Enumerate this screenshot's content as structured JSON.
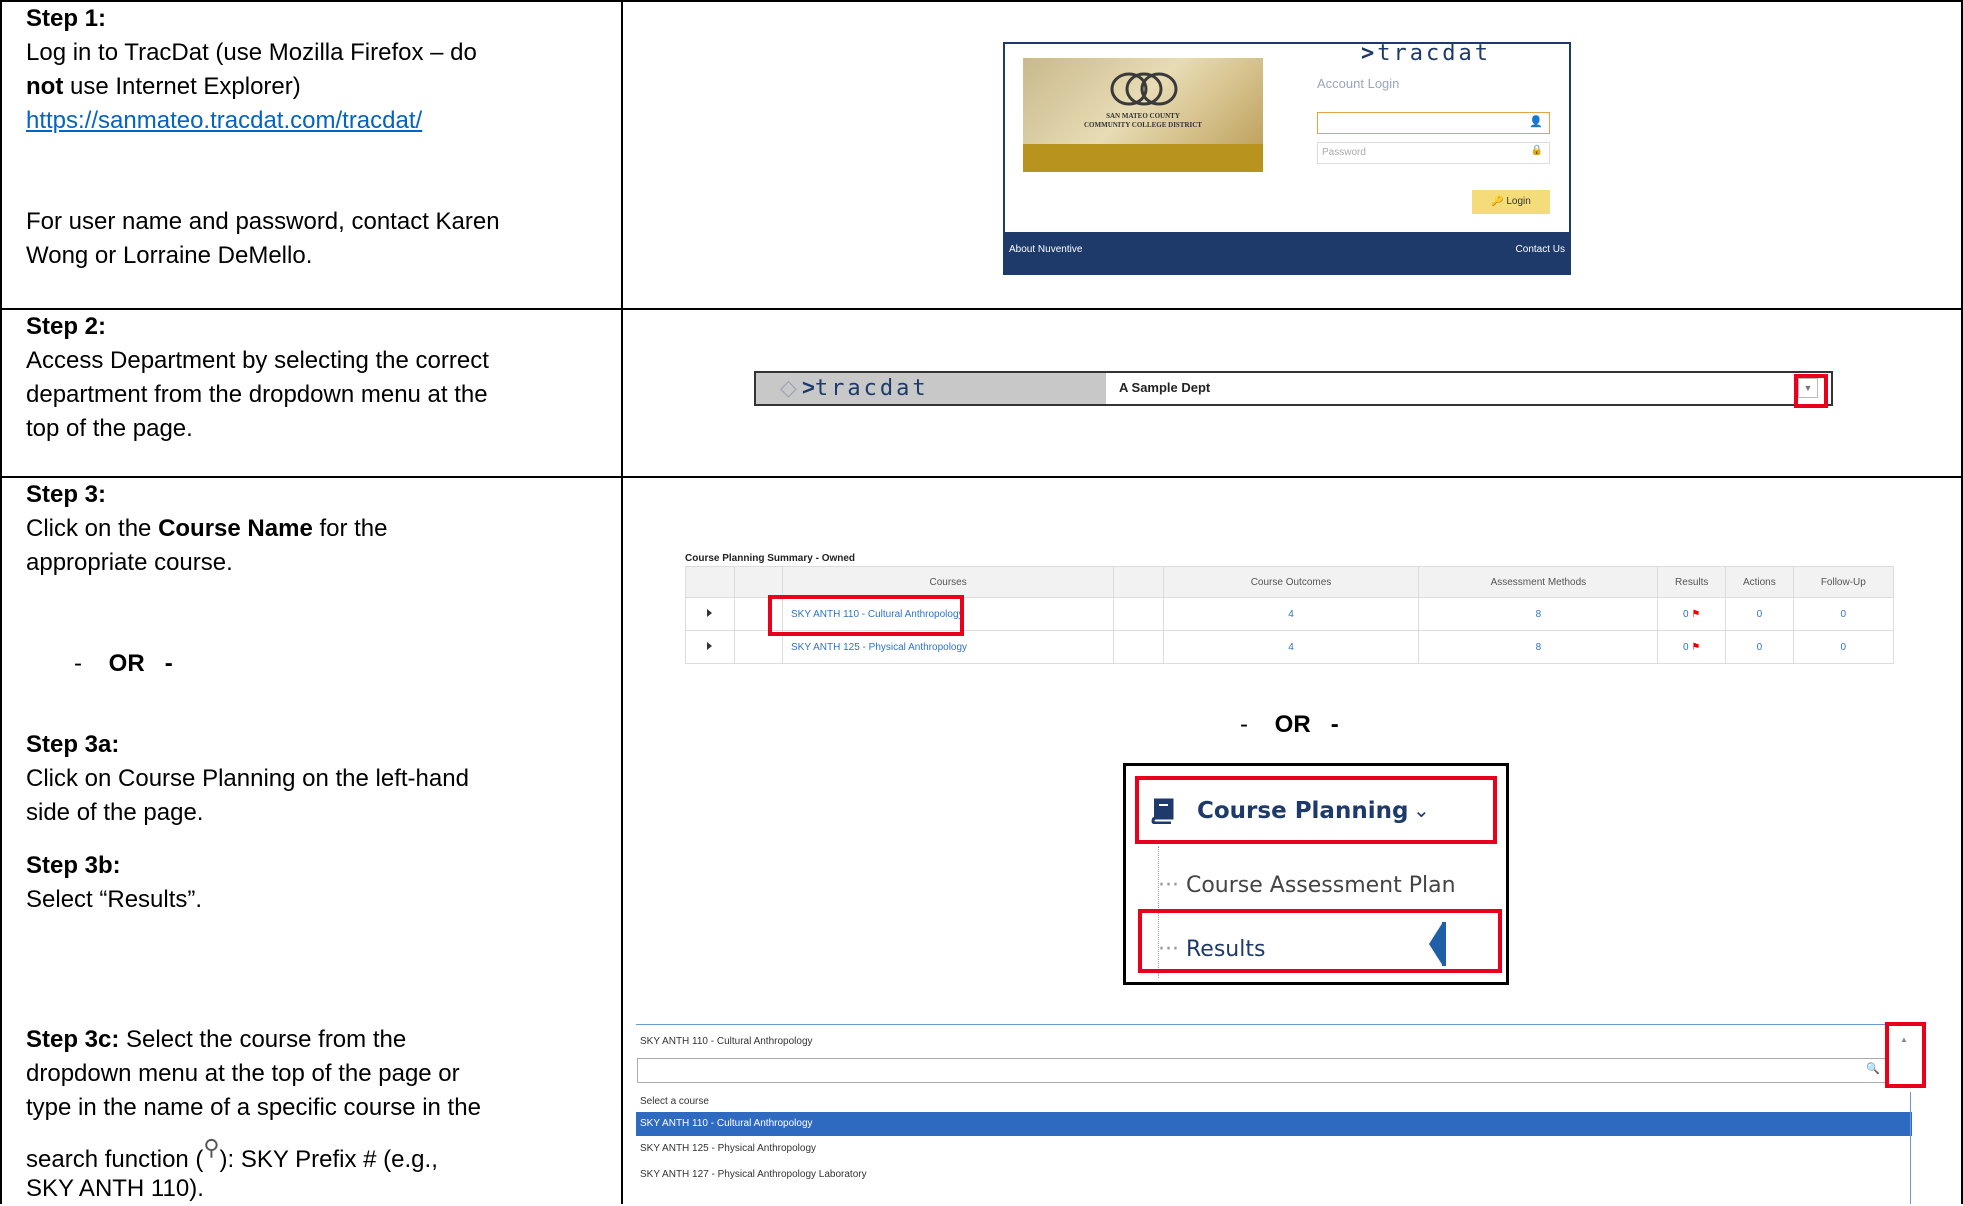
{
  "step1": {
    "heading": "Step 1:",
    "line1": "Log in to TracDat (use Mozilla Firefox – do",
    "bold_not": "not",
    "line2_rest": " use Internet Explorer)",
    "url": "https://sanmateo.tracdat.com/tracdat/",
    "contact_line1": "For user name and password, contact Karen",
    "contact_line2": "Wong or Lorraine DeMello.",
    "login_screen": {
      "brand": "tracdat",
      "district_line1": "San Mateo County",
      "district_line2": "Community College District",
      "account_login": "Account Login",
      "password_placeholder": "Password",
      "login_button": "Login",
      "footer_left": "About Nuventive",
      "footer_right": "Contact Us"
    }
  },
  "step2": {
    "heading": "Step 2:",
    "line1": "Access Department by selecting the correct",
    "line2": "department from the dropdown menu at the",
    "line3": "top of the page.",
    "brand": "tracdat",
    "dept_value": "A Sample Dept"
  },
  "step3": {
    "heading": "Step 3:",
    "line1_pre": "Click on the ",
    "line1_bold": "Course Name",
    "line1_post": " for the",
    "line2": "appropriate course.",
    "or_text": "OR",
    "table": {
      "title": "Course Planning Summary - Owned",
      "headers": [
        "Courses",
        "Course Outcomes",
        "Assessment Methods",
        "Results",
        "Actions",
        "Follow-Up"
      ],
      "rows": [
        {
          "course": "SKY ANTH 110 - Cultural Anthropology",
          "outcomes": "4",
          "methods": "8",
          "results": "0",
          "actions": "0",
          "followup": "0"
        },
        {
          "course": "SKY ANTH 125 - Physical Anthropology",
          "outcomes": "4",
          "methods": "8",
          "results": "0",
          "actions": "0",
          "followup": "0"
        }
      ]
    }
  },
  "step3a": {
    "heading": "Step 3a:",
    "line1": "Click on Course Planning on the left-hand",
    "line2": "side of the page.",
    "menu_title": "Course Planning",
    "menu_item1": "Course Assessment Plan",
    "menu_item2": "Results"
  },
  "step3b": {
    "heading": "Step 3b:",
    "line1": "Select “Results”."
  },
  "step3c": {
    "heading": "Step 3c:",
    "line1_rest": " Select the course from the",
    "line2": "dropdown menu at the top of the page or",
    "line3": "type in the name of a specific course in the",
    "line4_pre": "search function (",
    "line4_post": "): SKY Prefix # (e.g.,",
    "line5": "SKY ANTH 110).",
    "dropdown": {
      "selected": "SKY ANTH 110 - Cultural Anthropology",
      "options": [
        "Select a course",
        "SKY ANTH 110 - Cultural Anthropology",
        "SKY ANTH 125 - Physical Anthropology",
        "SKY ANTH 127 - Physical Anthropology Laboratory"
      ]
    }
  }
}
